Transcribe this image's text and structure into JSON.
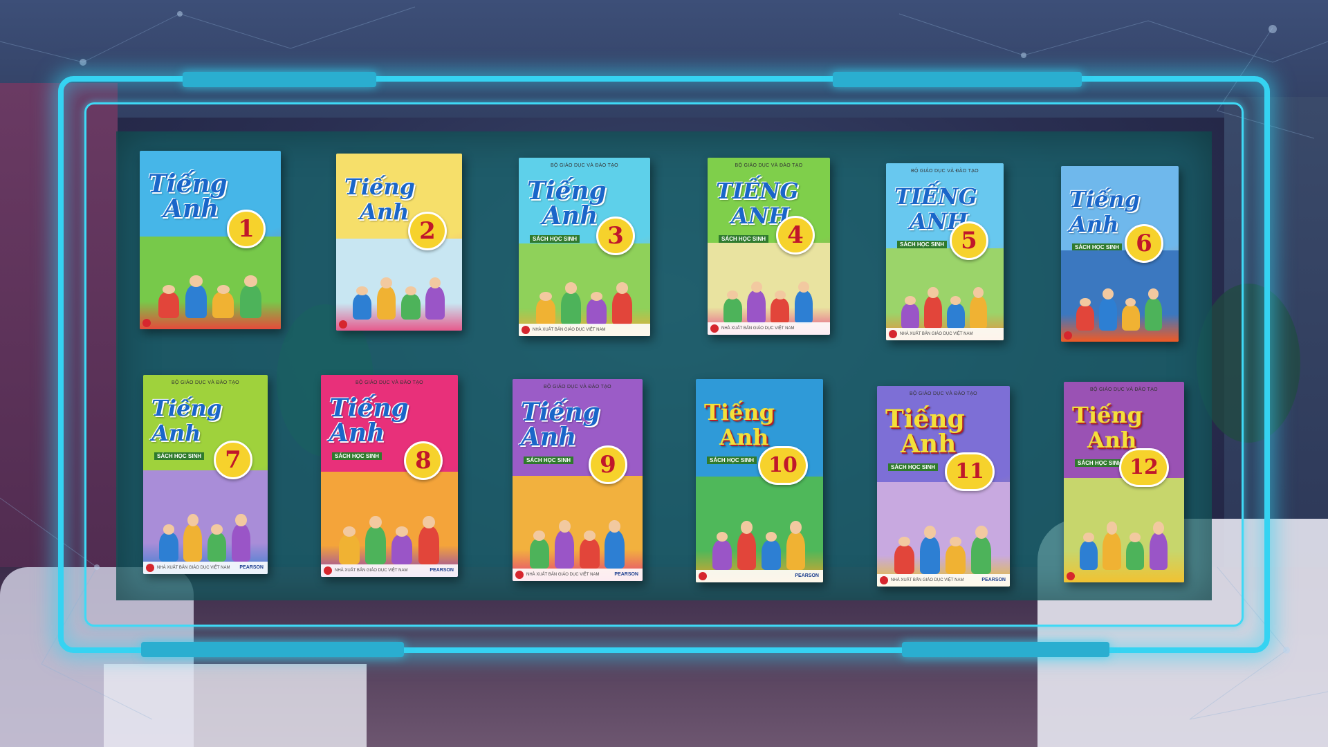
{
  "frame_color": "#35d3f2",
  "books": [
    {
      "title_line1": "Tiếng",
      "title_line2": "Anh",
      "grade": "1",
      "publisher": "",
      "subtitle": "",
      "footer": "",
      "pearson": "",
      "bg": "#46b6e8",
      "scene": "#77c94a",
      "accent": "#e64a3b"
    },
    {
      "title_line1": "Tiếng",
      "title_line2": "Anh",
      "grade": "2",
      "publisher": "",
      "subtitle": "",
      "footer": "",
      "pearson": "",
      "bg": "#f6df6a",
      "scene": "#c8e6f2",
      "accent": "#e65a8c"
    },
    {
      "title_line1": "Tiếng",
      "title_line2": "Anh",
      "grade": "3",
      "publisher": "BỘ GIÁO DỤC VÀ ĐÀO TẠO",
      "subtitle": "SÁCH HỌC SINH",
      "footer": "NHÀ XUẤT BẢN GIÁO DỤC VIỆT NAM",
      "pearson": "",
      "bg": "#5ed0ea",
      "scene": "#8fd15a",
      "accent": "#f2a93a"
    },
    {
      "title_line1": "TIẾNG",
      "title_line2": "ANH",
      "grade": "4",
      "publisher": "BỘ GIÁO DỤC VÀ ĐÀO TẠO",
      "subtitle": "SÁCH HỌC SINH",
      "footer": "NHÀ XUẤT BẢN GIÁO DỤC VIỆT NAM",
      "pearson": "",
      "bg": "#7fcf4b",
      "scene": "#e9e3a0",
      "accent": "#e84b8a"
    },
    {
      "title_line1": "TIẾNG",
      "title_line2": "ANH",
      "grade": "5",
      "publisher": "BỘ GIÁO DỤC VÀ ĐÀO TẠO",
      "subtitle": "SÁCH HỌC SINH",
      "footer": "NHÀ XUẤT BẢN GIÁO DỤC VIỆT NAM",
      "pearson": "",
      "bg": "#68c8ef",
      "scene": "#9bd46a",
      "accent": "#f08a3a"
    },
    {
      "title_line1": "Tiếng Anh",
      "title_line2": "",
      "grade": "6",
      "publisher": "",
      "subtitle": "SÁCH HỌC SINH",
      "footer": "",
      "pearson": "",
      "bg": "#6fb8ec",
      "scene": "#3b78c0",
      "accent": "#f15a24"
    },
    {
      "title_line1": "Tiếng Anh",
      "title_line2": "",
      "grade": "7",
      "publisher": "BỘ GIÁO DỤC VÀ ĐÀO TẠO",
      "subtitle": "SÁCH HỌC SINH",
      "footer": "NHÀ XUẤT BẢN GIÁO DỤC VIỆT NAM",
      "pearson": "PEARSON",
      "bg": "#9fd23c",
      "scene": "#a98dd8",
      "accent": "#3a7fd1"
    },
    {
      "title_line1": "Tiếng Anh",
      "title_line2": "",
      "grade": "8",
      "publisher": "BỘ GIÁO DỤC VÀ ĐÀO TẠO",
      "subtitle": "SÁCH HỌC SINH",
      "footer": "NHÀ XUẤT BẢN GIÁO DỤC VIỆT NAM",
      "pearson": "PEARSON",
      "bg": "#e8307a",
      "scene": "#f4a43a",
      "accent": "#8a3fb8"
    },
    {
      "title_line1": "Tiếng Anh",
      "title_line2": "",
      "grade": "9",
      "publisher": "BỘ GIÁO DỤC VÀ ĐÀO TẠO",
      "subtitle": "SÁCH HỌC SINH",
      "footer": "NHÀ XUẤT BẢN GIÁO DỤC VIỆT NAM",
      "pearson": "PEARSON",
      "bg": "#9b5cc7",
      "scene": "#f2b13e",
      "accent": "#e33b7a"
    },
    {
      "title_line1": "Tiếng",
      "title_line2": "Anh",
      "grade": "10",
      "publisher": "",
      "subtitle": "SÁCH HỌC SINH",
      "footer": "",
      "pearson": "PEARSON",
      "bg": "#2f9ad8",
      "scene": "#4fb85a",
      "accent": "#e8a12a"
    },
    {
      "title_line1": "Tiếng",
      "title_line2": "Anh",
      "grade": "11",
      "publisher": "BỘ GIÁO DỤC VÀ ĐÀO TẠO",
      "subtitle": "SÁCH HỌC SINH",
      "footer": "NHÀ XUẤT BẢN GIÁO DỤC VIỆT NAM",
      "pearson": "PEARSON",
      "bg": "#7d6fd6",
      "scene": "#c8a9e0",
      "accent": "#e8c12a"
    },
    {
      "title_line1": "Tiếng",
      "title_line2": "Anh",
      "grade": "12",
      "publisher": "BỘ GIÁO DỤC VÀ ĐÀO TẠO",
      "subtitle": "SÁCH HỌC SINH",
      "footer": "",
      "pearson": "",
      "bg": "#9a52b4",
      "scene": "#c7d66c",
      "accent": "#f1c232"
    }
  ]
}
